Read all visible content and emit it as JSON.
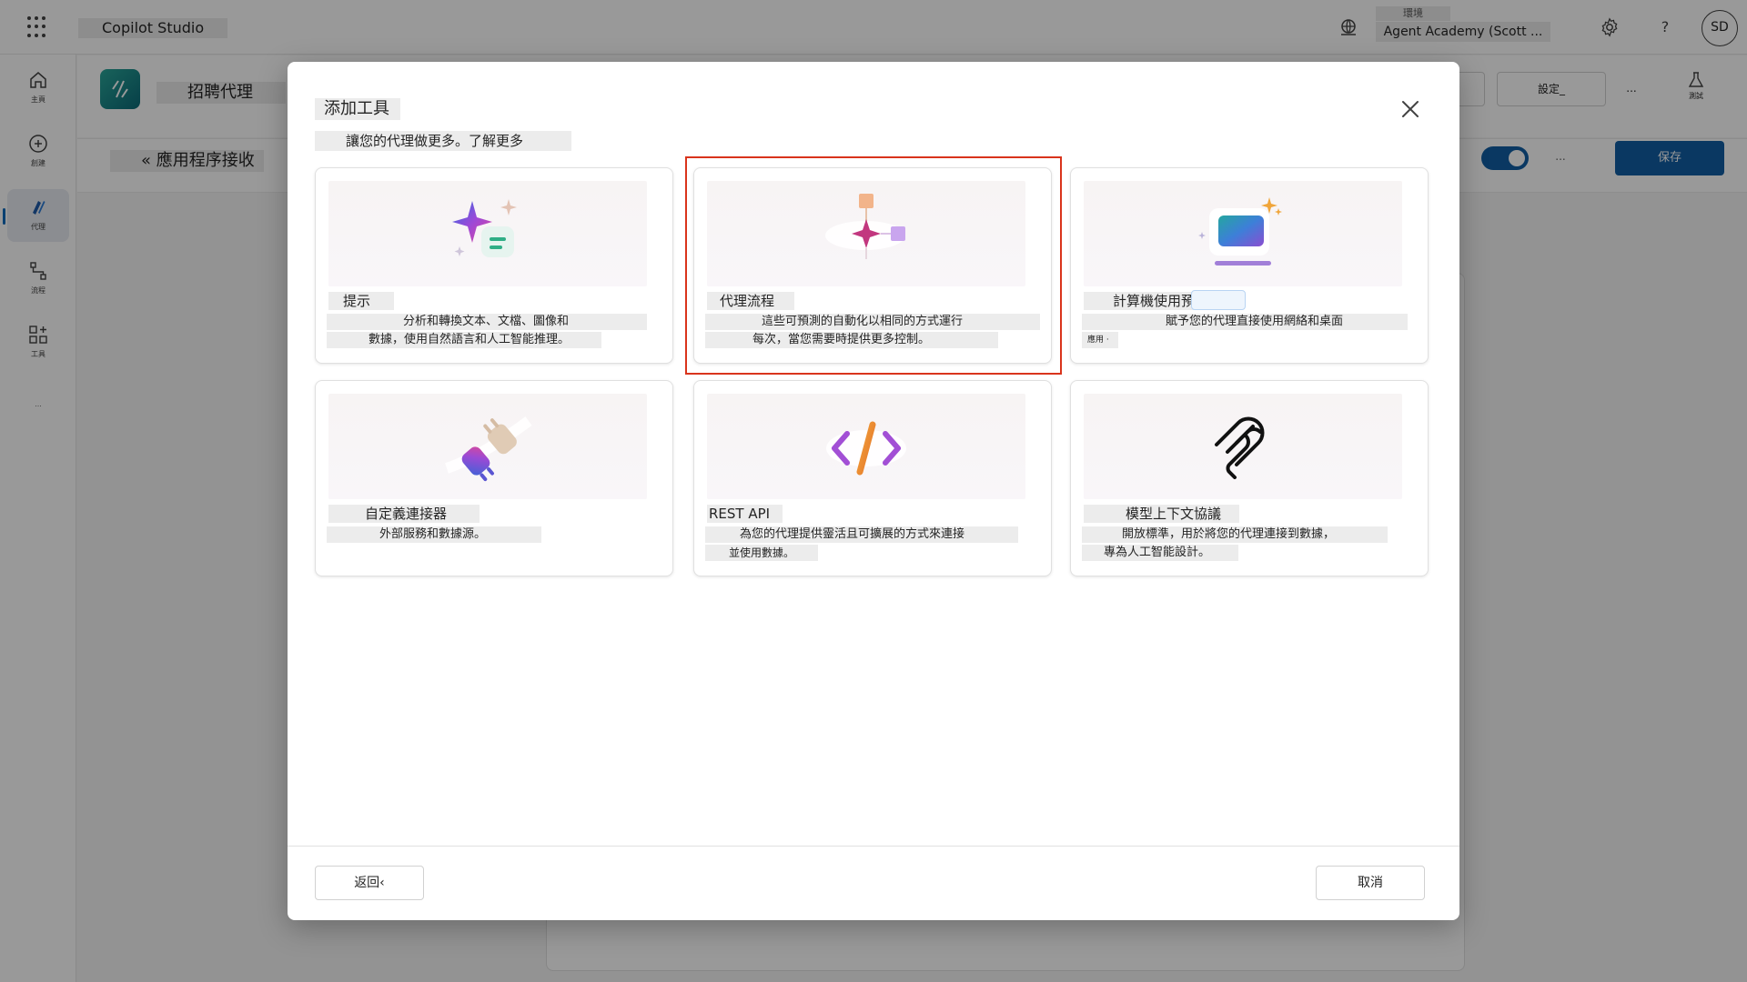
{
  "topbar": {
    "app_title": "Copilot Studio",
    "env_label": "環境",
    "env_name": "Agent Academy (Scott ...",
    "help_label": "?",
    "avatar_initials": "SD"
  },
  "leftrail": {
    "items": [
      {
        "label": "主頁",
        "icon": "home-icon"
      },
      {
        "label": "創建",
        "icon": "create-icon"
      },
      {
        "label": "代理",
        "icon": "agents-icon"
      },
      {
        "label": "流程",
        "icon": "flows-icon"
      },
      {
        "label": "工具",
        "icon": "tools-icon"
      }
    ],
    "more_label": "..."
  },
  "agent_header": {
    "name": "招聘代理",
    "settings_label": "設定_",
    "more_label": "...",
    "test_label": "測試"
  },
  "sub_header": {
    "breadcrumb": "« 應用程序接收",
    "more_label": "...",
    "save_label": "保存"
  },
  "dialog": {
    "title": "添加工具",
    "subtitle": "讓您的代理做更多。了解更多",
    "cards": [
      {
        "title": "提示",
        "desc_line1": "分析和轉換文本、文檔、圖像和",
        "desc_line2": "數據，使用自然語言和人工智能推理。",
        "icon": "prompt-sparkle-icon"
      },
      {
        "title": "代理流程",
        "desc_line1": "這些可預測的自動化以相同的方式運行",
        "desc_line2": "每次，當您需要時提供更多控制。",
        "icon": "agent-flow-icon",
        "highlighted": true
      },
      {
        "title": "計算機使用預覽",
        "desc_line1": "賦予您的代理直接使用網絡和桌面",
        "desc_line2": "應用 ·",
        "icon": "computer-use-icon"
      },
      {
        "title": "自定義連接器",
        "desc_line1": "外部服務和數據源。",
        "desc_line2": "",
        "icon": "plug-connector-icon"
      },
      {
        "title": "REST API",
        "desc_line1": "為您的代理提供靈活且可擴展的方式來連接",
        "desc_line2": "並使用數據。",
        "icon": "code-brackets-icon"
      },
      {
        "title": "模型上下文協議",
        "desc_line1": "開放標準，用於將您的代理連接到數據，",
        "desc_line2": "專為人工智能設計。",
        "icon": "mcp-icon"
      }
    ],
    "back_label": "返回‹",
    "cancel_label": "取消"
  },
  "colors": {
    "primary": "#115ea3",
    "highlight_border": "#d9341c",
    "overlay": "rgba(0,0,0,0.40)"
  }
}
